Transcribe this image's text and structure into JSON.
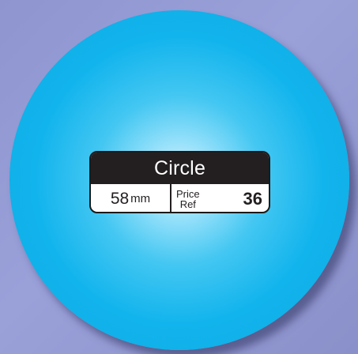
{
  "shape": {
    "name": "Circle",
    "size_value": "58",
    "size_unit": "mm",
    "price_label_line1": "Price",
    "price_label_line2": "Ref",
    "price_ref": "36"
  },
  "colors": {
    "background": "#9499d3",
    "circle": "#0ea8e2",
    "label_header": "#231f20",
    "label_text": "#231f20"
  }
}
